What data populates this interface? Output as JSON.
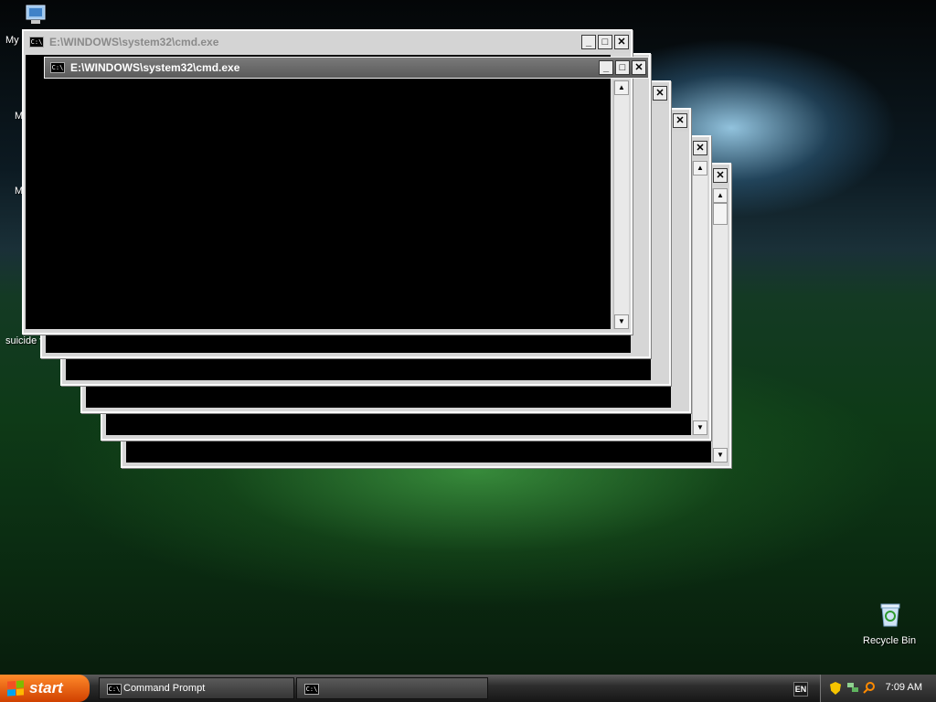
{
  "desktop": {
    "icons": [
      {
        "label": "My"
      },
      {
        "label": "M"
      },
      {
        "label": "M"
      },
      {
        "label": "suicide v"
      },
      {
        "label": "Recycle Bin"
      }
    ]
  },
  "windows": {
    "back_title": "E:\\WINDOWS\\system32\\cmd.exe",
    "front_title": "E:\\WINDOWS\\system32\\cmd.exe",
    "icon_text": "C:\\",
    "minimize": "_",
    "maximize": "□",
    "close": "✕"
  },
  "taskbar": {
    "start_label": "start",
    "task_label": "Command Prompt",
    "lang": "EN",
    "clock": "7:09 AM"
  },
  "colors": {
    "start_orange": "#e85c10",
    "console_bg": "#000000",
    "active_title": "#6a6a6a"
  }
}
